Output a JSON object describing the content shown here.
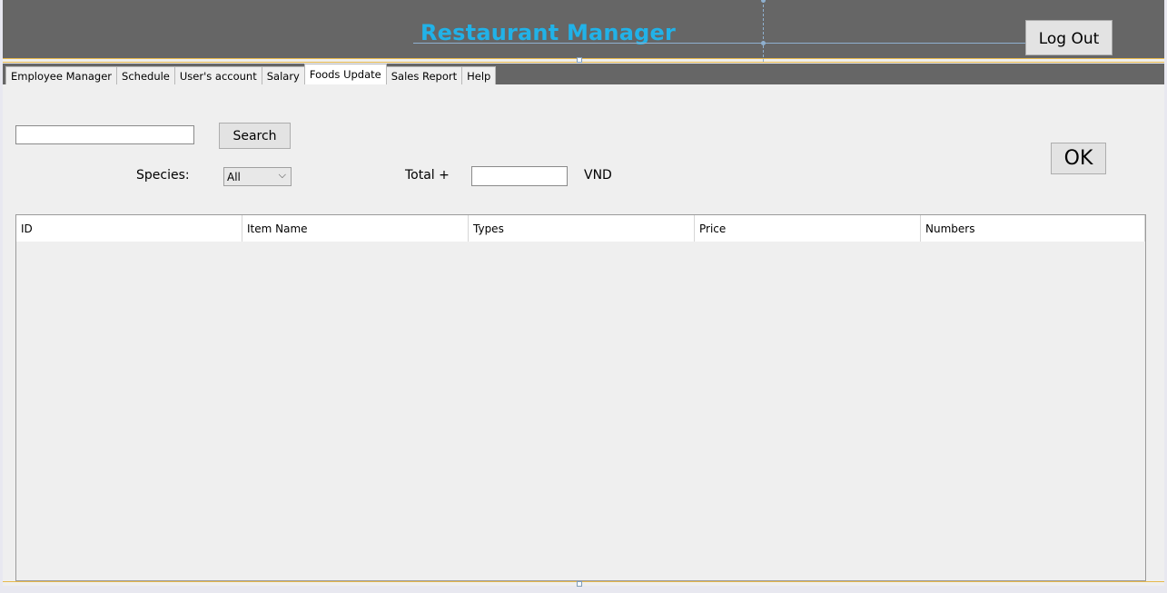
{
  "header": {
    "title": "Restaurant Manager",
    "title_color": "#21b2e8",
    "background": "#666666",
    "logout_label": "Log Out"
  },
  "tabs": [
    {
      "label": "Employee Manager",
      "active": false
    },
    {
      "label": "Schedule",
      "active": false
    },
    {
      "label": "User's account",
      "active": false
    },
    {
      "label": "Salary",
      "active": false
    },
    {
      "label": "Foods Update",
      "active": true
    },
    {
      "label": "Sales Report",
      "active": false
    },
    {
      "label": "Help",
      "active": false
    }
  ],
  "search": {
    "value": "",
    "button_label": "Search"
  },
  "species": {
    "label": "Species:",
    "selected": "All"
  },
  "total": {
    "label": "Total +",
    "value": "",
    "currency": "VND"
  },
  "ok_label": "OK",
  "table": {
    "columns": [
      "ID",
      "Item Name",
      "Types",
      "Price",
      "Numbers"
    ],
    "rows": []
  }
}
